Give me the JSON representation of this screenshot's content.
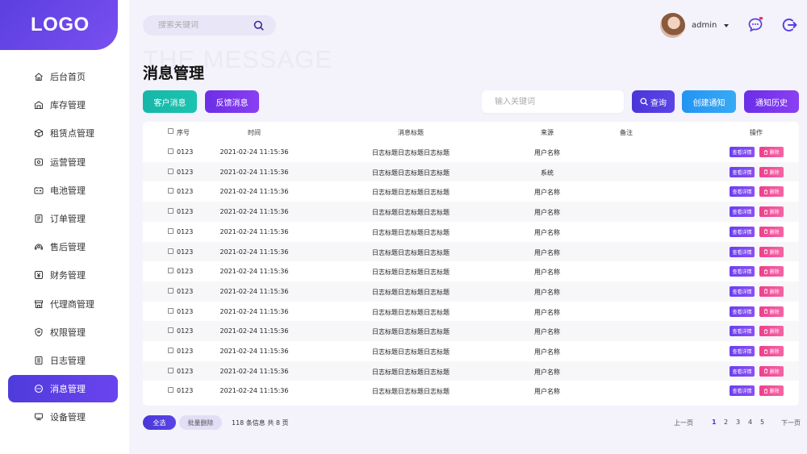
{
  "brand": {
    "logo": "LOGO",
    "accent": "#5b3fe0"
  },
  "header": {
    "search_placeholder": "搜索关键词",
    "username": "admin",
    "icons": [
      "search-icon",
      "chat-icon",
      "logout-icon"
    ]
  },
  "sidebar": {
    "items": [
      {
        "label": "后台首页",
        "icon": "home-icon"
      },
      {
        "label": "库存管理",
        "icon": "warehouse-icon"
      },
      {
        "label": "租赁点管理",
        "icon": "box-icon"
      },
      {
        "label": "运营管理",
        "icon": "operation-icon"
      },
      {
        "label": "电池管理",
        "icon": "battery-icon"
      },
      {
        "label": "订单管理",
        "icon": "order-icon"
      },
      {
        "label": "售后管理",
        "icon": "service-icon"
      },
      {
        "label": "财务管理",
        "icon": "yuan-icon"
      },
      {
        "label": "代理商管理",
        "icon": "store-icon"
      },
      {
        "label": "权限管理",
        "icon": "shield-icon"
      },
      {
        "label": "日志管理",
        "icon": "log-icon"
      },
      {
        "label": "消息管理",
        "icon": "message-icon",
        "active": true
      },
      {
        "label": "设备管理",
        "icon": "device-icon"
      }
    ]
  },
  "page": {
    "watermark": "THE MESSAGE",
    "title": "消息管理",
    "buttons": {
      "customer": "客户消息",
      "feedback": "反馈消息",
      "query": "查询",
      "create": "创建通知",
      "history": "通知历史"
    },
    "keyword_placeholder": "输入关键词"
  },
  "table": {
    "headers": {
      "seq": "序号",
      "time": "时间",
      "title": "消息标题",
      "source": "来源",
      "note": "备注",
      "action": "操作"
    },
    "action_view": "查看详情",
    "action_delete": "删除",
    "rows": [
      {
        "seq": "0123",
        "time": "2021-02-24  11:15:36",
        "title": "日志标题日志标题日志标题",
        "source": "用户名称"
      },
      {
        "seq": "0123",
        "time": "2021-02-24  11:15:36",
        "title": "日志标题日志标题日志标题",
        "source": "系统"
      },
      {
        "seq": "0123",
        "time": "2021-02-24  11:15:36",
        "title": "日志标题日志标题日志标题",
        "source": "用户名称"
      },
      {
        "seq": "0123",
        "time": "2021-02-24  11:15:36",
        "title": "日志标题日志标题日志标题",
        "source": "用户名称"
      },
      {
        "seq": "0123",
        "time": "2021-02-24  11:15:36",
        "title": "日志标题日志标题日志标题",
        "source": "用户名称"
      },
      {
        "seq": "0123",
        "time": "2021-02-24  11:15:36",
        "title": "日志标题日志标题日志标题",
        "source": "用户名称"
      },
      {
        "seq": "0123",
        "time": "2021-02-24  11:15:36",
        "title": "日志标题日志标题日志标题",
        "source": "用户名称"
      },
      {
        "seq": "0123",
        "time": "2021-02-24  11:15:36",
        "title": "日志标题日志标题日志标题",
        "source": "用户名称"
      },
      {
        "seq": "0123",
        "time": "2021-02-24  11:15:36",
        "title": "日志标题日志标题日志标题",
        "source": "用户名称"
      },
      {
        "seq": "0123",
        "time": "2021-02-24  11:15:36",
        "title": "日志标题日志标题日志标题",
        "source": "用户名称"
      },
      {
        "seq": "0123",
        "time": "2021-02-24  11:15:36",
        "title": "日志标题日志标题日志标题",
        "source": "用户名称"
      },
      {
        "seq": "0123",
        "time": "2021-02-24  11:15:36",
        "title": "日志标题日志标题日志标题",
        "source": "用户名称"
      },
      {
        "seq": "0123",
        "time": "2021-02-24  11:15:36",
        "title": "日志标题日志标题日志标题",
        "source": "用户名称"
      }
    ]
  },
  "footer": {
    "select_all": "全选",
    "batch_delete": "批量删除",
    "info": "118 条信息 共 8 页",
    "prev": "上一页",
    "pages": [
      "1",
      "2",
      "3",
      "4",
      "5"
    ],
    "current_page": "1",
    "next": "下一页"
  }
}
